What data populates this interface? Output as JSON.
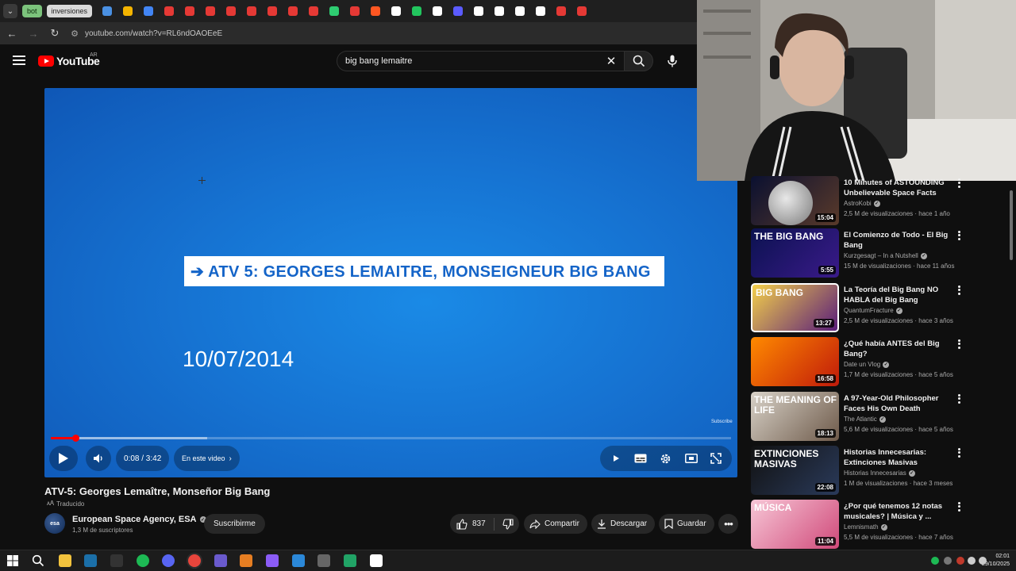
{
  "browser": {
    "tab_pills": [
      "bot",
      "inversiones"
    ],
    "url": "youtube.com/watch?v=RL6ndOAOEeE"
  },
  "header": {
    "logo_text": "YouTube",
    "country": "AR",
    "search_value": "big bang lemaitre"
  },
  "player": {
    "banner_text": "➔ ATV 5: GEORGES LEMAITRE, MONSEIGNEUR BIG BANG",
    "date_text": "10/07/2014",
    "watermark": "Subscribe",
    "time": "0:08 / 3:42",
    "chapters_label": "En este video",
    "progress_fraction": 0.036,
    "buffer_fraction": 0.23
  },
  "video": {
    "title": "ATV-5: Georges Lemaître, Monseñor Big Bang",
    "translated_label": "Traducido",
    "channel_name": "European Space Agency, ESA",
    "channel_avatar_text": "esa",
    "subscribers": "1,3 M de suscriptores",
    "subscribe_label": "Suscribirme",
    "likes": "837",
    "share_label": "Compartir",
    "download_label": "Descargar",
    "save_label": "Guardar"
  },
  "recommendations": [
    {
      "title": "10 Minutes of ASTOUNDING Unbelievable Space Facts",
      "channel": "AstroKobi",
      "meta": "2,5 M de visualizaciones · hace 1 año",
      "duration": "15:04",
      "thumb_text": "",
      "colors": [
        "#0a1030",
        "#5a3a2a"
      ]
    },
    {
      "title": "El Comienzo de Todo - El Big Bang",
      "channel": "Kurzgesagt – In a Nutshell",
      "meta": "15 M de visualizaciones · hace 11 años",
      "duration": "5:55",
      "thumb_text": "THE BIG BANG",
      "colors": [
        "#0b1250",
        "#3a1a8a"
      ]
    },
    {
      "title": "La Teoría del Big Bang NO HABLA del Big Bang",
      "channel": "QuantumFracture",
      "meta": "2,5 M de visualizaciones · hace 3 años",
      "duration": "13:27",
      "thumb_text": "BIG BANG",
      "colors": [
        "#f4d04a",
        "#5a1d7a"
      ]
    },
    {
      "title": "¿Qué había ANTES del Big Bang?",
      "channel": "Date un Vlog",
      "meta": "1,7 M de visualizaciones · hace 5 años",
      "duration": "16:58",
      "thumb_text": "",
      "colors": [
        "#ff8a00",
        "#c01a0a"
      ]
    },
    {
      "title": "A 97-Year-Old Philosopher Faces His Own Death",
      "channel": "The Atlantic",
      "meta": "5,6 M de visualizaciones · hace 5 años",
      "duration": "18:13",
      "thumb_text": "THE MEANING OF LIFE",
      "colors": [
        "#d8d2c8",
        "#6e5a4a"
      ]
    },
    {
      "title": "Historias Innecesarias: Extinciones Masivas",
      "channel": "Historias Innecesarias",
      "meta": "1 M de visualizaciones · hace 3 meses",
      "duration": "22:08",
      "thumb_text": "EXTINCIONES MASIVAS",
      "colors": [
        "#111111",
        "#2a3a5a"
      ]
    },
    {
      "title": "¿Por qué tenemos 12 notas musicales? | Música y ...",
      "channel": "Lemnismath",
      "meta": "5,5 M de visualizaciones · hace 7 años",
      "duration": "11:04",
      "thumb_text": "MÚSICA",
      "colors": [
        "#f7c6d6",
        "#d04a7a"
      ]
    }
  ],
  "taskbar": {
    "time": "02:01",
    "date": "29/10/2025"
  },
  "colors": {
    "youtube_red": "#ff0000",
    "background": "#0f0f0f",
    "player_blue": "#1673d2"
  }
}
